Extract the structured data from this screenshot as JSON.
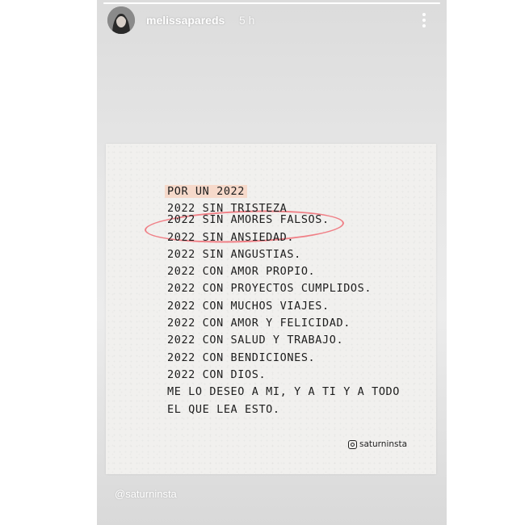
{
  "story": {
    "progress": 1.0,
    "username": "melissapareds",
    "time": "5 h",
    "avatar_icon": "profile-photo",
    "more_icon": "vertical-ellipsis-icon",
    "tag": "@saturninsta"
  },
  "post": {
    "lines": [
      "POR UN 2022",
      "2022 SIN TRISTEZA",
      "2022 SIN AMORES FALSOS.",
      "2022 SIN ANSIEDAD.",
      "2022 SIN ANGUSTIAS.",
      "2022 CON AMOR PROPIO.",
      "2022 CON PROYECTOS CUMPLIDOS.",
      "2022 CON MUCHOS VIAJES.",
      "2022 CON AMOR Y FELICIDAD.",
      "2022 CON SALUD Y TRABAJO.",
      "2022 CON BENDICIONES.",
      "2022 CON DIOS.",
      "ME LO DESEO A MI, Y A TI Y A TODO",
      "EL QUE LEA ESTO."
    ],
    "handle": "saturninsta",
    "handle_icon": "instagram-icon",
    "highlight_color": "#f6d9ca",
    "circle_color": "#f07f86"
  }
}
